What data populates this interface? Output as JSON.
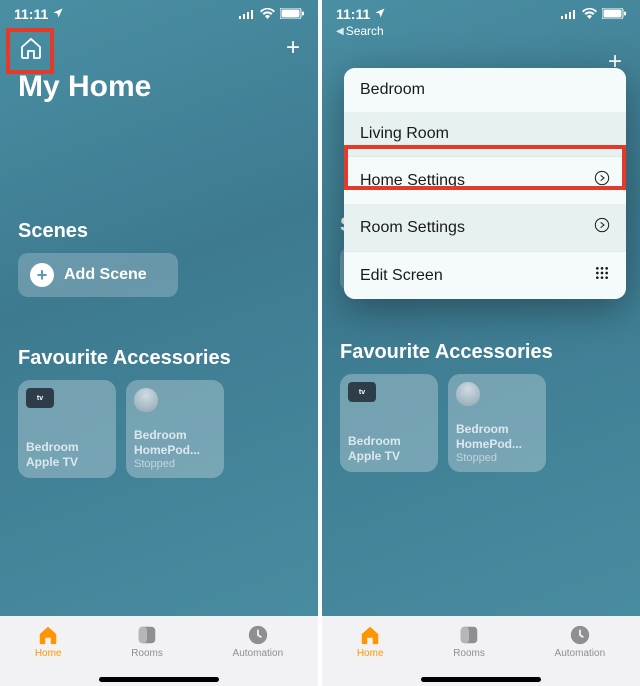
{
  "status": {
    "time": "11:11",
    "location_glyph": "➤",
    "signal_glyph": "ıııl",
    "wifi_glyph": "wifi",
    "battery_glyph": "bat"
  },
  "back_search_label": "Search",
  "page_title": "My Home",
  "sections": {
    "scenes": "Scenes",
    "favourites": "Favourite Accessories"
  },
  "add_scene_label": "Add Scene",
  "tiles": [
    {
      "icon_label": "tv",
      "line1": "Bedroom",
      "line2": "Apple TV",
      "sub": ""
    },
    {
      "icon_label": "",
      "line1": "Bedroom",
      "line2": "HomePod...",
      "sub": "Stopped"
    }
  ],
  "tabs": {
    "home": "Home",
    "rooms": "Rooms",
    "automation": "Automation"
  },
  "popover": {
    "items": [
      {
        "label": "Bedroom",
        "icon": ""
      },
      {
        "label": "Living Room",
        "icon": ""
      },
      {
        "label": "Home Settings",
        "icon": "chevron"
      },
      {
        "label": "Room Settings",
        "icon": "chevron"
      },
      {
        "label": "Edit Screen",
        "icon": "grid"
      }
    ]
  }
}
